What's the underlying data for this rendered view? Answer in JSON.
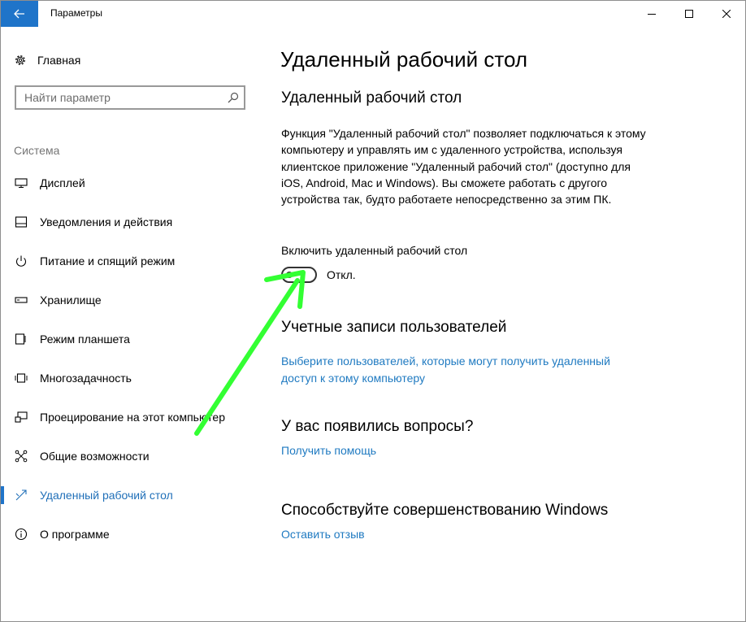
{
  "window": {
    "title": "Параметры"
  },
  "sidebar": {
    "home_label": "Главная",
    "search_placeholder": "Найти параметр",
    "section_label": "Система",
    "items": [
      {
        "label": "Дисплей",
        "icon": "monitor-icon"
      },
      {
        "label": "Уведомления и действия",
        "icon": "notification-icon"
      },
      {
        "label": "Питание и спящий режим",
        "icon": "power-icon"
      },
      {
        "label": "Хранилище",
        "icon": "storage-icon"
      },
      {
        "label": "Режим планшета",
        "icon": "tablet-icon"
      },
      {
        "label": "Многозадачность",
        "icon": "multitasking-icon"
      },
      {
        "label": "Проецирование на этот компьютер",
        "icon": "projecting-icon"
      },
      {
        "label": "Общие возможности",
        "icon": "shared-experiences-icon"
      },
      {
        "label": "Удаленный рабочий стол",
        "icon": "remote-desktop-icon",
        "active": true
      },
      {
        "label": "О программе",
        "icon": "info-icon"
      }
    ]
  },
  "main": {
    "page_title": "Удаленный рабочий стол",
    "section_title": "Удаленный рабочий стол",
    "description": "Функция \"Удаленный рабочий стол\" позволяет подключаться к этому компьютеру и управлять им с удаленного устройства, используя клиентское приложение \"Удаленный рабочий стол\" (доступно для iOS, Android, Mac и Windows). Вы сможете работать с другого устройства так, будто работаете непосредственно за этим ПК.",
    "toggle_label": "Включить удаленный рабочий стол",
    "toggle_state": "Откл.",
    "toggle_on": false,
    "accounts_title": "Учетные записи пользователей",
    "accounts_link": "Выберите пользователей, которые могут получить удаленный доступ к этому компьютеру",
    "questions_title": "У вас появились вопросы?",
    "help_link": "Получить помощь",
    "improve_title": "Способствуйте совершенствованию Windows",
    "feedback_link": "Оставить отзыв"
  },
  "colors": {
    "accent": "#1f74c9",
    "link": "#1f7ac1",
    "annotation_arrow": "#33ff33"
  }
}
